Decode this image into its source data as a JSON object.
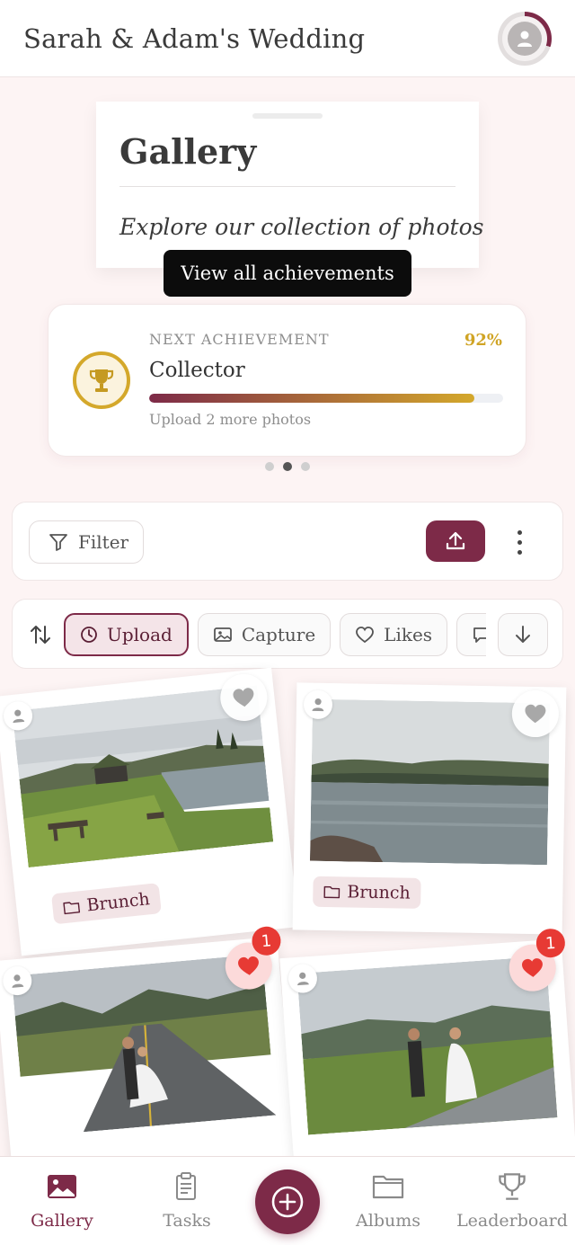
{
  "header": {
    "title": "Sarah & Adam's Wedding",
    "profile_progress_color": "#7d2a48"
  },
  "intro": {
    "title": "Gallery",
    "subtitle": "Explore our collection of photos"
  },
  "tooltip": {
    "label": "View all achievements"
  },
  "achievement": {
    "label": "NEXT ACHIEVEMENT",
    "name": "Collector",
    "percent_text": "92%",
    "progress": 0.92,
    "hint": "Upload 2 more photos",
    "icon": "trophy-icon"
  },
  "carousel": {
    "page_count": 3,
    "active_index": 1
  },
  "toolbar": {
    "filter_label": "Filter",
    "upload_icon": "upload-icon",
    "more_icon": "more-vertical-icon"
  },
  "sort": {
    "chips": [
      {
        "label": "Upload",
        "icon": "clock-icon",
        "active": true
      },
      {
        "label": "Capture",
        "icon": "image-icon",
        "active": false
      },
      {
        "label": "Likes",
        "icon": "heart-icon",
        "active": false
      },
      {
        "label": "Comments",
        "icon": "comment-icon",
        "active": false
      }
    ],
    "direction_icon": "arrow-down-icon",
    "toggle_icon": "sort-toggle-icon"
  },
  "photos": [
    {
      "album": "Brunch",
      "likes": null,
      "liked": false,
      "scene": "cabin by the lake"
    },
    {
      "album": "Brunch",
      "likes": null,
      "liked": false,
      "scene": "mountain lake"
    },
    {
      "album": "",
      "likes": "1",
      "liked": true,
      "scene": "couple on the road"
    },
    {
      "album": "",
      "likes": "1",
      "liked": true,
      "scene": "couple walking"
    }
  ],
  "nav": {
    "items": [
      {
        "label": "Gallery",
        "icon": "gallery-icon",
        "active": true
      },
      {
        "label": "Tasks",
        "icon": "clipboard-icon",
        "active": false
      },
      {
        "label": "Albums",
        "icon": "folder-icon",
        "active": false
      },
      {
        "label": "Leaderboard",
        "icon": "trophy-icon",
        "active": false
      }
    ],
    "fab_icon": "add-icon"
  },
  "colors": {
    "brand": "#7d2a48",
    "gold": "#d4a82b",
    "badge": "#e73a34",
    "background": "#fdf4f4"
  }
}
